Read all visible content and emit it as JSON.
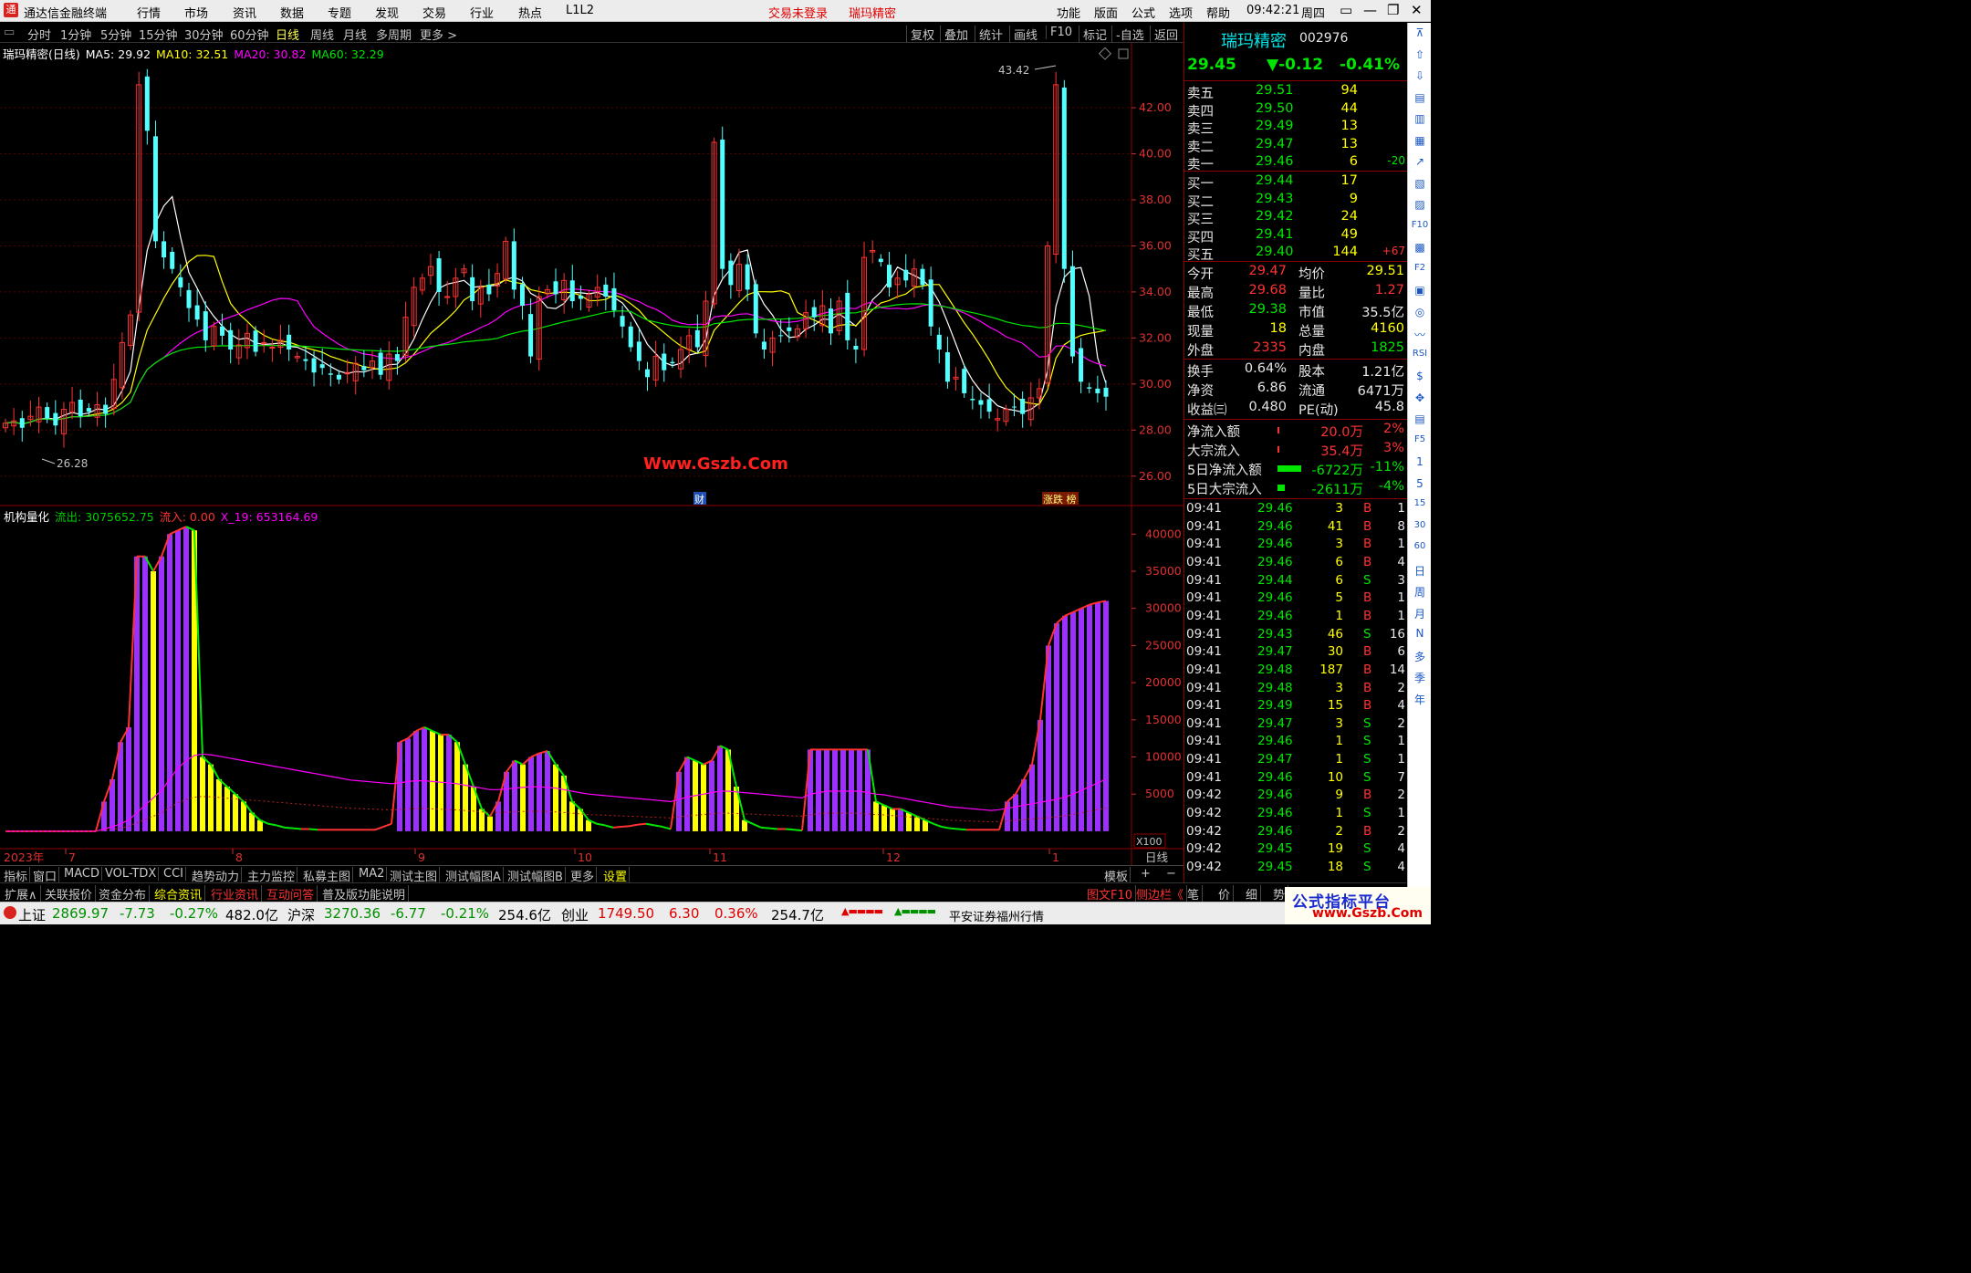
{
  "app": {
    "logo_glyph": "通",
    "title": "通达信金融终端",
    "menus": [
      "行情",
      "市场",
      "资讯",
      "数据",
      "专题",
      "发现",
      "交易",
      "行业",
      "热点",
      "L1L2"
    ],
    "login_status": "交易未登录",
    "stock_name": "瑞玛精密",
    "right_menus": [
      "功能",
      "版面",
      "公式",
      "选项",
      "帮助"
    ],
    "time": "09:42:21",
    "weekday": "周四"
  },
  "window_buttons": [
    "▭",
    "—",
    "❐",
    "✕"
  ],
  "toolbar": {
    "periods": [
      "分时",
      "1分钟",
      "5分钟",
      "15分钟",
      "30分钟",
      "60分钟",
      "日线",
      "周线",
      "月线",
      "多周期",
      "更多 >"
    ],
    "active": "日线",
    "tools": [
      "复权",
      "叠加",
      "统计",
      "画线",
      "F10",
      "标记",
      "-自选",
      "返回"
    ]
  },
  "main_chart": {
    "title": "瑞玛精密(日线)",
    "ma": [
      {
        "label": "MA5: 29.92",
        "color": "#ffffff"
      },
      {
        "label": "MA10: 32.51",
        "color": "#ffff00"
      },
      {
        "label": "MA20: 30.82",
        "color": "#ff00ff"
      },
      {
        "label": "MA60: 32.29",
        "color": "#00e600"
      }
    ],
    "high_label": "43.42",
    "low_label": "26.28",
    "watermark": "Www.Gszb.Com",
    "cai_mark": "财",
    "tag_mark": "涨跌 榜"
  },
  "sub_chart": {
    "title": "机构量化",
    "items": [
      {
        "label": "流出: 3075652.75",
        "color": "#00cc00"
      },
      {
        "label": "流入: 0.00",
        "color": "#ff3232"
      },
      {
        "label": "X_19: 653164.69",
        "color": "#ff00ff"
      }
    ],
    "unit": "X100"
  },
  "bottom_tabs": [
    "指标",
    "窗口",
    "MACD",
    "VOL-TDX",
    "CCI",
    "趋势动力",
    "主力监控",
    "私募主图",
    "MA2",
    "测试主图",
    "测试幅图A",
    "测试幅图B",
    "更多",
    "设置"
  ],
  "bottom_right": [
    "模板",
    "+",
    "−"
  ],
  "info_tabs": [
    {
      "t": "扩展∧",
      "c": "#c8c8c8"
    },
    {
      "t": "关联报价",
      "c": "#c8c8c8"
    },
    {
      "t": "资金分布",
      "c": "#c8c8c8"
    },
    {
      "t": "综合资讯",
      "c": "#ffff00"
    },
    {
      "t": "行业资讯",
      "c": "#ff3232"
    },
    {
      "t": "互动问答",
      "c": "#ff3232"
    },
    {
      "t": "普及版功能说明",
      "c": "#c8c8c8"
    }
  ],
  "info_right": [
    {
      "t": "图文F10",
      "c": "#ff3232"
    },
    {
      "t": "侧边栏《",
      "c": "#ff3232"
    },
    {
      "t": "笔",
      "c": "#c8c8c8"
    },
    {
      "t": "价",
      "c": "#c8c8c8"
    },
    {
      "t": "细",
      "c": "#c8c8c8"
    },
    {
      "t": "势",
      "c": "#c8c8c8"
    }
  ],
  "chart_data": [
    {
      "type": "candlestick",
      "title": "瑞玛精密(日线)",
      "x": [
        "2023-07",
        "2023-08",
        "2023-09",
        "2023-10",
        "2023-11",
        "2023-12",
        "2024-01"
      ],
      "x_tick_labels": [
        "2023年",
        "7",
        "8",
        "9",
        "10",
        "11",
        "12",
        "1",
        "日线"
      ],
      "y_ticks": [
        26,
        28,
        30,
        32,
        34,
        36,
        38,
        40,
        42
      ],
      "y_tick_labels": [
        "26.00",
        "28.00",
        "30.00",
        "32.00",
        "34.00",
        "36.00",
        "38.00",
        "40.00",
        "42.00"
      ],
      "ylim": [
        25,
        44.5
      ],
      "high": 43.42,
      "low": 26.28,
      "close": [
        28.3,
        28.4,
        28.1,
        28.6,
        29.0,
        28.5,
        28.2,
        28.9,
        29.2,
        28.6,
        28.8,
        29.1,
        28.7,
        30.2,
        31.8,
        33.0,
        43.0,
        41.0,
        36.2,
        35.5,
        35.0,
        34.2,
        33.3,
        32.8,
        31.9,
        32.5,
        32.1,
        31.5,
        31.7,
        32.2,
        31.4,
        31.8,
        31.6,
        31.9,
        31.5,
        31.2,
        31.0,
        30.5,
        30.7,
        30.4,
        30.2,
        30.5,
        30.9,
        30.6,
        31.0,
        30.4,
        31.3,
        31.0,
        32.9,
        34.2,
        34.6,
        35.1,
        34.0,
        33.8,
        34.6,
        35.0,
        33.6,
        34.2,
        33.9,
        34.8,
        36.2,
        34.1,
        33.4,
        31.2,
        33.8,
        34.1,
        33.9,
        34.5,
        33.6,
        33.7,
        33.9,
        34.2,
        33.8,
        33.2,
        32.5,
        31.6,
        31.0,
        30.3,
        31.2,
        30.6,
        30.9,
        31.5,
        32.1,
        31.6,
        33.6,
        40.5,
        35.0,
        34.3,
        35.2,
        34.1,
        32.2,
        31.5,
        32.0,
        32.1,
        32.3,
        32.4,
        33.1,
        32.9,
        33.4,
        32.2,
        33.6,
        31.9,
        31.5,
        35.5,
        35.8,
        35.3,
        34.2,
        34.6,
        34.5,
        35.0,
        34.3,
        32.5,
        31.5,
        30.1,
        30.3,
        29.6,
        29.3,
        29.1,
        28.8,
        28.5,
        28.9,
        29.0,
        28.7,
        29.4,
        29.8,
        36.0,
        43.0,
        35.0,
        31.2,
        30.1,
        29.8,
        29.6,
        29.45
      ],
      "ma_latest": {
        "MA5": 29.92,
        "MA10": 32.51,
        "MA20": 30.82,
        "MA60": 32.29
      }
    },
    {
      "type": "bar",
      "title": "机构量化",
      "unit": "X100",
      "y_ticks": [
        5000,
        10000,
        15000,
        20000,
        25000,
        30000,
        35000,
        40000
      ],
      "y_tick_labels": [
        "5000",
        "10000",
        "15000",
        "20000",
        "25000",
        "30000",
        "35000",
        "40000"
      ],
      "ylim": [
        -500,
        42000
      ],
      "series": [
        {
          "name": "流出",
          "latest": 3075652.75
        },
        {
          "name": "流入",
          "latest": 0.0
        },
        {
          "name": "X_19",
          "latest": 653164.69
        }
      ],
      "values": [
        0,
        0,
        0,
        0,
        0,
        0,
        0,
        0,
        0,
        0,
        0,
        0,
        4000,
        7000,
        12000,
        14000,
        37000,
        37000,
        35000,
        37000,
        40000,
        40500,
        41000,
        40500,
        10000,
        9000,
        7000,
        6000,
        5000,
        4000,
        2500,
        1500,
        1000,
        800,
        500,
        400,
        300,
        300,
        200,
        200,
        200,
        200,
        200,
        200,
        200,
        200,
        600,
        1000,
        12000,
        12500,
        13500,
        14000,
        13500,
        13000,
        13000,
        12000,
        9000,
        6000,
        3000,
        2000,
        4000,
        8000,
        9500,
        9000,
        10000,
        10500,
        10800,
        9000,
        7500,
        4000,
        3000,
        1500,
        1000,
        800,
        500,
        600,
        700,
        900,
        1000,
        800,
        600,
        300,
        8000,
        10000,
        9500,
        9000,
        9500,
        11500,
        11000,
        6000,
        1500,
        1000,
        500,
        400,
        300,
        300,
        200,
        100,
        11000,
        11000,
        11000,
        11000,
        11000,
        11000,
        11000,
        11000,
        4000,
        3500,
        3000,
        3000,
        2500,
        2000,
        1500,
        1000,
        600,
        400,
        300,
        200,
        200,
        200,
        200,
        200,
        4000,
        5000,
        7000,
        9000,
        15000,
        25000,
        28000,
        29000,
        29500,
        30000,
        30500,
        30800,
        31000
      ],
      "x19": [
        0,
        0,
        0,
        0,
        0,
        0,
        0,
        0,
        0,
        0,
        0,
        0,
        300,
        600,
        1000,
        1500,
        2500,
        3500,
        4500,
        5500,
        7000,
        8500,
        9500,
        10200,
        10400,
        10300,
        10100,
        9900,
        9700,
        9500,
        9300,
        9100,
        8900,
        8700,
        8500,
        8300,
        8100,
        7900,
        7700,
        7500,
        7300,
        7100,
        6900,
        6800,
        6700,
        6600,
        6500,
        6400,
        6500,
        6700,
        6800,
        6800,
        6700,
        6600,
        6500,
        6400,
        6200,
        6000,
        5800,
        5600,
        5600,
        5700,
        5800,
        5900,
        6000,
        6000,
        5900,
        5800,
        5600,
        5400,
        5200,
        5000,
        4900,
        4800,
        4700,
        4600,
        4500,
        4400,
        4300,
        4200,
        4100,
        4000,
        4300,
        4600,
        4800,
        5000,
        5200,
        5400,
        5400,
        5300,
        5200,
        5100,
        5000,
        4900,
        4800,
        4700,
        4600,
        4500,
        5000,
        5200,
        5400,
        5400,
        5400,
        5400,
        5400,
        5200,
        5000,
        4900,
        4700,
        4500,
        4300,
        4100,
        3900,
        3700,
        3500,
        3300,
        3200,
        3100,
        3000,
        2900,
        2800,
        2900,
        3100,
        3300,
        3500,
        3700,
        3900,
        4100,
        4300,
        4600,
        5000,
        5500,
        6000,
        6500,
        7000
      ]
    }
  ],
  "quote": {
    "name": "瑞玛精密",
    "code": "002976",
    "price": "29.45",
    "change": "▼-0.12",
    "pct": "-0.41%",
    "sell": [
      {
        "l": "卖五",
        "p": "29.51",
        "v": "94",
        "d": ""
      },
      {
        "l": "卖四",
        "p": "29.50",
        "v": "44",
        "d": ""
      },
      {
        "l": "卖三",
        "p": "29.49",
        "v": "13",
        "d": ""
      },
      {
        "l": "卖二",
        "p": "29.47",
        "v": "13",
        "d": ""
      },
      {
        "l": "卖一",
        "p": "29.46",
        "v": "6",
        "d": "-20"
      }
    ],
    "buy": [
      {
        "l": "买一",
        "p": "29.44",
        "v": "17",
        "d": ""
      },
      {
        "l": "买二",
        "p": "29.43",
        "v": "9",
        "d": ""
      },
      {
        "l": "买三",
        "p": "29.42",
        "v": "24",
        "d": ""
      },
      {
        "l": "买四",
        "p": "29.41",
        "v": "49",
        "d": ""
      },
      {
        "l": "买五",
        "p": "29.40",
        "v": "144",
        "d": "+67"
      }
    ],
    "stats": [
      [
        "今开",
        "29.47",
        "均价",
        "29.51"
      ],
      [
        "最高",
        "29.68",
        "量比",
        "1.27"
      ],
      [
        "最低",
        "29.38",
        "市值",
        "35.5亿"
      ],
      [
        "现量",
        "18",
        "总量",
        "4160"
      ],
      [
        "外盘",
        "2335",
        "内盘",
        "1825"
      ]
    ],
    "stats2": [
      [
        "换手",
        "0.64%",
        "股本",
        "1.21亿"
      ],
      [
        "净资",
        "6.86",
        "流通",
        "6471万"
      ],
      [
        "收益㈢",
        "0.480",
        "PE(动)",
        "45.8"
      ]
    ],
    "flows": [
      [
        "净流入额",
        "20.0万",
        "2%"
      ],
      [
        "大宗流入",
        "35.4万",
        "3%"
      ],
      [
        "5日净流入额",
        "-6722万",
        "-11%"
      ],
      [
        "5日大宗流入",
        "-2611万",
        "-4%"
      ]
    ],
    "ticks": [
      [
        "09:41",
        "29.46",
        "3",
        "B",
        "1"
      ],
      [
        "09:41",
        "29.46",
        "41",
        "B",
        "8"
      ],
      [
        "09:41",
        "29.46",
        "3",
        "B",
        "1"
      ],
      [
        "09:41",
        "29.46",
        "6",
        "B",
        "4"
      ],
      [
        "09:41",
        "29.44",
        "6",
        "S",
        "3"
      ],
      [
        "09:41",
        "29.46",
        "5",
        "B",
        "1"
      ],
      [
        "09:41",
        "29.46",
        "1",
        "B",
        "1"
      ],
      [
        "09:41",
        "29.43",
        "46",
        "S",
        "16"
      ],
      [
        "09:41",
        "29.47",
        "30",
        "B",
        "6"
      ],
      [
        "09:41",
        "29.48",
        "187",
        "B",
        "14"
      ],
      [
        "09:41",
        "29.48",
        "3",
        "B",
        "2"
      ],
      [
        "09:41",
        "29.49",
        "15",
        "B",
        "4"
      ],
      [
        "09:41",
        "29.47",
        "3",
        "S",
        "2"
      ],
      [
        "09:41",
        "29.46",
        "1",
        "S",
        "1"
      ],
      [
        "09:41",
        "29.47",
        "1",
        "S",
        "1"
      ],
      [
        "09:41",
        "29.46",
        "10",
        "S",
        "7"
      ],
      [
        "09:42",
        "29.46",
        "9",
        "B",
        "2"
      ],
      [
        "09:42",
        "29.46",
        "1",
        "S",
        "1"
      ],
      [
        "09:42",
        "29.46",
        "2",
        "B",
        "2"
      ],
      [
        "09:42",
        "29.45",
        "19",
        "S",
        "4"
      ],
      [
        "09:42",
        "29.45",
        "18",
        "S",
        "4"
      ]
    ]
  },
  "sidebar": [
    "⊼",
    "⇧",
    "⇩",
    "▤",
    "▥",
    "▦",
    "↗",
    "▧",
    "▨",
    "F10",
    "▩",
    "F2",
    "▣",
    "◎",
    "〰",
    "RSI",
    "$",
    "✥",
    "▤",
    "F5",
    "1",
    "5",
    "15",
    "30",
    "60",
    "日",
    "周",
    "月",
    "N",
    "多",
    "季",
    "年"
  ],
  "status": {
    "indices": [
      {
        "name": "上证",
        "value": "2869.97",
        "chg": "-7.73",
        "pct": "-0.27%",
        "amt": "482.0亿"
      },
      {
        "name": "沪深",
        "value": "3270.36",
        "chg": "-6.77",
        "pct": "-0.21%",
        "amt": "254.6亿"
      },
      {
        "name": "创业",
        "value": "1749.50",
        "chg": "6.30",
        "pct": "0.36%",
        "amt": "254.7亿"
      }
    ],
    "broker": "平安证券福州行情",
    "brand": "公式指标平台",
    "brand_url": "www.Gszb.Com"
  }
}
